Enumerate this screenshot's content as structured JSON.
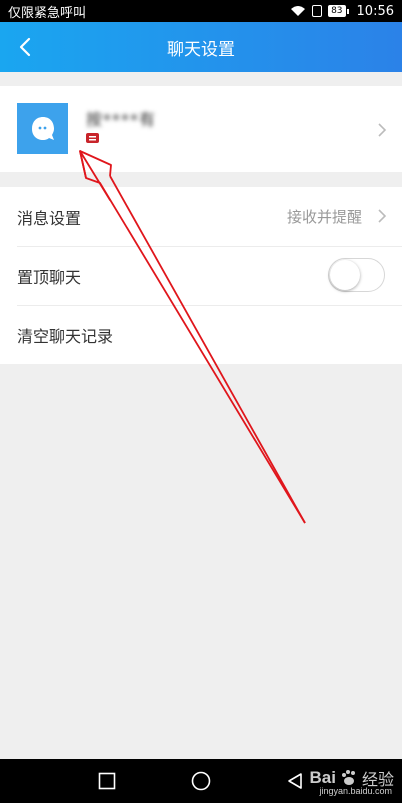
{
  "status_bar": {
    "carrier_text": "仅限紧急呼叫",
    "battery_level": "83",
    "time": "10:56"
  },
  "header": {
    "title": "聊天设置"
  },
  "profile": {
    "name": "按****有"
  },
  "settings": {
    "items": [
      {
        "label": "消息设置",
        "value": "接收并提醒"
      },
      {
        "label": "置顶聊天",
        "toggle_on": false
      },
      {
        "label": "清空聊天记录"
      }
    ]
  },
  "watermark": {
    "logo": "Bai",
    "text": "经验",
    "url": "jingyan.baidu.com"
  },
  "colors": {
    "header_start": "#1aa6f0",
    "header_end": "#2b82e8",
    "avatar": "#3da2ec",
    "annotation_arrow": "#e0161c"
  },
  "icons": [
    "wifi-icon",
    "sim-icon",
    "battery-icon",
    "back-arrow-icon",
    "avatar-face-icon",
    "badge-icon",
    "chevron-right-icon",
    "nav-recent-icon",
    "nav-home-icon",
    "nav-back-icon",
    "baidu-paw-icon"
  ]
}
